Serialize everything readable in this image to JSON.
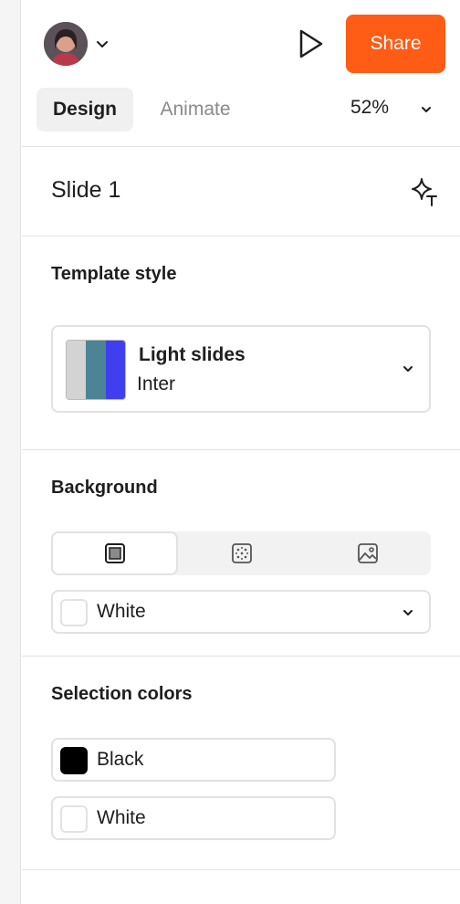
{
  "header": {
    "share_label": "Share",
    "tabs": [
      {
        "label": "Design",
        "active": true
      },
      {
        "label": "Animate",
        "active": false
      }
    ],
    "zoom": "52%",
    "accent_color": "#ff5c16"
  },
  "slide": {
    "title": "Slide 1"
  },
  "template_style": {
    "title": "Template style",
    "name": "Light slides",
    "font": "Inter",
    "swatch_colors": [
      "#d3d3d3",
      "#4c8496",
      "#3f3ff0"
    ]
  },
  "background": {
    "title": "Background",
    "modes": [
      "solid",
      "pattern",
      "image"
    ],
    "active_mode": "solid",
    "color_name": "White",
    "color_hex": "#ffffff"
  },
  "selection_colors": {
    "title": "Selection colors",
    "items": [
      {
        "name": "Black",
        "hex": "#000000"
      },
      {
        "name": "White",
        "hex": "#ffffff"
      }
    ]
  },
  "icons": [
    "chevron-down-icon",
    "play-icon",
    "ai-text-sparkle-icon",
    "solid-fill-icon",
    "pattern-fill-icon",
    "image-fill-icon"
  ]
}
